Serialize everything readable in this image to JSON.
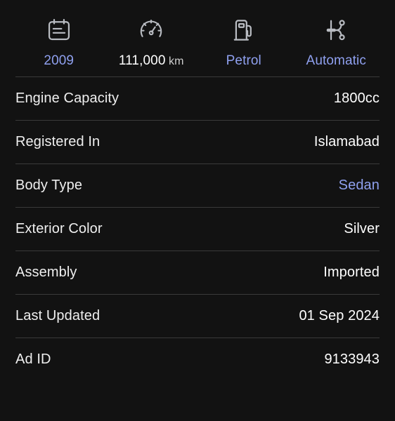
{
  "theme": {
    "background": "#121212",
    "link_color": "#8fa0ef",
    "text_color": "#ffffff",
    "divider_color": "#3a3a3a"
  },
  "spec_strip": {
    "items": [
      {
        "icon": "calendar-icon",
        "label": "2009",
        "unit": "",
        "is_link": true
      },
      {
        "icon": "speedometer-icon",
        "label": "111,000",
        "unit": "km",
        "is_link": false
      },
      {
        "icon": "fuel-pump-icon",
        "label": "Petrol",
        "unit": "",
        "is_link": true
      },
      {
        "icon": "transmission-icon",
        "label": "Automatic",
        "unit": "",
        "is_link": true
      }
    ]
  },
  "details": {
    "rows": [
      {
        "label": "Engine Capacity",
        "value": "1800cc",
        "is_link": false
      },
      {
        "label": "Registered In",
        "value": "Islamabad",
        "is_link": false
      },
      {
        "label": "Body Type",
        "value": "Sedan",
        "is_link": true
      },
      {
        "label": "Exterior Color",
        "value": "Silver",
        "is_link": false
      },
      {
        "label": "Assembly",
        "value": "Imported",
        "is_link": false
      },
      {
        "label": "Last Updated",
        "value": "01 Sep 2024",
        "is_link": false
      },
      {
        "label": "Ad ID",
        "value": "9133943",
        "is_link": false
      }
    ]
  }
}
